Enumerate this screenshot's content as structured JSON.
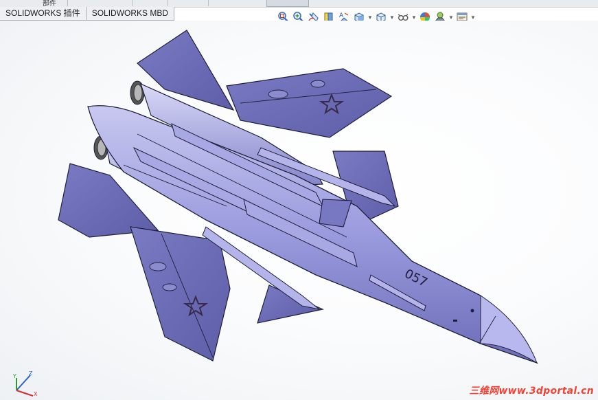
{
  "top_tabs": {
    "partial_label": "部件"
  },
  "command_tabs": [
    {
      "label": "SOLIDWORKS 插件"
    },
    {
      "label": "SOLIDWORKS MBD"
    }
  ],
  "view_toolbar": [
    {
      "icon": "zoom-to-fit-icon"
    },
    {
      "icon": "zoom-to-area-icon"
    },
    {
      "icon": "previous-view-icon"
    },
    {
      "icon": "section-view-icon"
    },
    {
      "icon": "dynamic-annotation-views-icon"
    },
    {
      "icon": "view-orientation-icon",
      "dropdown": true
    },
    {
      "icon": "display-style-icon",
      "dropdown": true
    },
    {
      "icon": "hide-show-items-icon",
      "dropdown": true
    },
    {
      "icon": "edit-appearance-icon"
    },
    {
      "icon": "apply-scene-icon",
      "dropdown": true
    },
    {
      "icon": "view-settings-icon",
      "dropdown": true
    }
  ],
  "model": {
    "tail_number": "057",
    "body_color": "#8f8fd6",
    "insignia_color": "#3a2a4a"
  },
  "triad": {
    "x": "X",
    "y": "Y",
    "z": "Z"
  },
  "watermark": "三维网www.3dportal.cn"
}
